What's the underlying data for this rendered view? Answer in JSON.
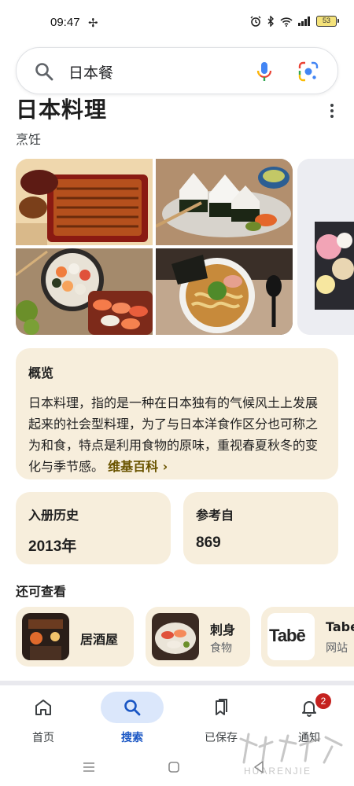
{
  "status_bar": {
    "time": "09:47",
    "fan_icon": "fan-icon",
    "battery_level": "53",
    "icons": [
      "alarm-icon",
      "bluetooth-icon",
      "wifi-icon",
      "signal-icon",
      "battery-icon"
    ]
  },
  "search": {
    "query": "日本餐",
    "icons": [
      "search-icon",
      "mic-icon",
      "lens-icon"
    ]
  },
  "entity": {
    "title": "日本料理",
    "subtitle": "烹饪"
  },
  "overview": {
    "heading": "概览",
    "text": "日本料理，指的是一种在日本独有的气候风土上发展起来的社会型料理，为了与日本洋食作区分也可称之为和食，特点是利用食物的原味，重视春夏秋冬的变化与季节感。",
    "source_link": "维基百科 ›"
  },
  "facts": {
    "history_label": "入册历史",
    "history_value": "2013年",
    "reference_label": "参考自",
    "reference_value": "869"
  },
  "see_also": {
    "title": "还可查看",
    "items": [
      {
        "name": "居酒屋",
        "sub": ""
      },
      {
        "name": "刺身",
        "sub": "食物"
      },
      {
        "name": "Tabe",
        "sub": "网站",
        "logo_text": "Tabē"
      }
    ]
  },
  "bottom_nav": {
    "items": [
      {
        "label": "首页",
        "icon": "home-icon"
      },
      {
        "label": "搜索",
        "icon": "search-icon",
        "active": true
      },
      {
        "label": "已保存",
        "icon": "bookmarks-icon"
      },
      {
        "label": "通知",
        "icon": "bell-icon",
        "badge": "2"
      }
    ]
  },
  "watermark": {
    "text": "HUARENJIE"
  },
  "colors": {
    "card_bg": "#f7eedc",
    "accent_blue": "#1a56c4",
    "active_pill": "#dbe7fb",
    "wiki_link": "#6a5400",
    "badge_red": "#c5221f"
  }
}
